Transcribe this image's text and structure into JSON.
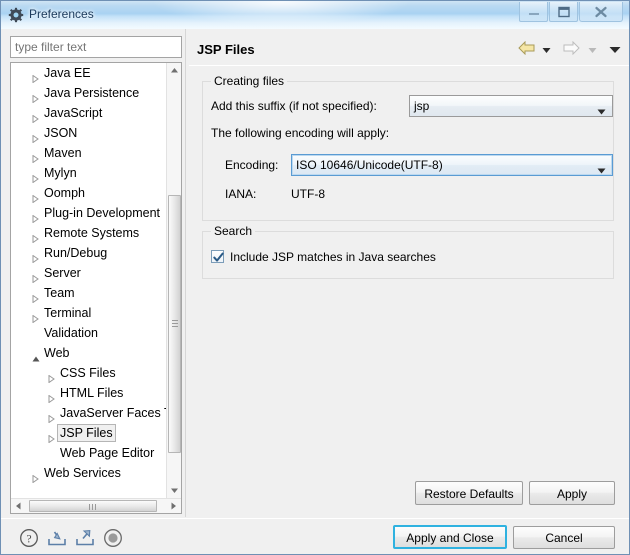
{
  "window": {
    "title": "Preferences",
    "icon": "gear-icon",
    "controls": {
      "minimize": "minimize-icon",
      "maximize": "maximize-icon",
      "close": "close-icon"
    }
  },
  "filter": {
    "value": "",
    "placeholder": "type filter text"
  },
  "tree": {
    "items": [
      {
        "label": "Java EE",
        "level": 1,
        "state": "collapsed",
        "selected": false
      },
      {
        "label": "Java Persistence",
        "level": 1,
        "state": "collapsed",
        "selected": false
      },
      {
        "label": "JavaScript",
        "level": 1,
        "state": "collapsed",
        "selected": false
      },
      {
        "label": "JSON",
        "level": 1,
        "state": "collapsed",
        "selected": false
      },
      {
        "label": "Maven",
        "level": 1,
        "state": "collapsed",
        "selected": false
      },
      {
        "label": "Mylyn",
        "level": 1,
        "state": "collapsed",
        "selected": false
      },
      {
        "label": "Oomph",
        "level": 1,
        "state": "collapsed",
        "selected": false
      },
      {
        "label": "Plug-in Development",
        "level": 1,
        "state": "collapsed",
        "selected": false
      },
      {
        "label": "Remote Systems",
        "level": 1,
        "state": "collapsed",
        "selected": false
      },
      {
        "label": "Run/Debug",
        "level": 1,
        "state": "collapsed",
        "selected": false
      },
      {
        "label": "Server",
        "level": 1,
        "state": "collapsed",
        "selected": false
      },
      {
        "label": "Team",
        "level": 1,
        "state": "collapsed",
        "selected": false
      },
      {
        "label": "Terminal",
        "level": 1,
        "state": "collapsed",
        "selected": false
      },
      {
        "label": "Validation",
        "level": 1,
        "state": "leaf",
        "selected": false
      },
      {
        "label": "Web",
        "level": 1,
        "state": "expanded",
        "selected": false
      },
      {
        "label": "CSS Files",
        "level": 2,
        "state": "collapsed",
        "selected": false
      },
      {
        "label": "HTML Files",
        "level": 2,
        "state": "collapsed",
        "selected": false
      },
      {
        "label": "JavaServer Faces To",
        "level": 2,
        "state": "collapsed",
        "selected": false
      },
      {
        "label": "JSP Files",
        "level": 2,
        "state": "collapsed",
        "selected": true
      },
      {
        "label": "Web Page Editor",
        "level": 2,
        "state": "leaf",
        "selected": false
      },
      {
        "label": "Web Services",
        "level": 1,
        "state": "collapsed",
        "selected": false
      }
    ]
  },
  "page": {
    "title": "JSP Files",
    "nav": {
      "back": "back-arrow-icon",
      "back_menu": "back-dropdown-icon",
      "forward": "forward-arrow-icon",
      "forward_menu": "forward-dropdown-icon",
      "menu": "view-menu-icon"
    },
    "groups": {
      "creating": {
        "title": "Creating files",
        "suffix_label": "Add this suffix (if not specified):",
        "suffix_value": "jsp",
        "encoding_note": "The following encoding will apply:",
        "encoding_label": "Encoding:",
        "encoding_value": "ISO 10646/Unicode(UTF-8)",
        "iana_label": "IANA:",
        "iana_value": "UTF-8"
      },
      "search": {
        "title": "Search",
        "checkbox_label": "Include JSP matches in Java searches",
        "checkbox_checked": true
      }
    },
    "buttons": {
      "restore_defaults": "Restore Defaults",
      "apply": "Apply"
    }
  },
  "bottom": {
    "icons": {
      "help": "help-icon",
      "import": "import-icon",
      "export": "export-icon",
      "record": "record-icon"
    },
    "apply_and_close": "Apply and Close",
    "cancel": "Cancel"
  },
  "colors": {
    "titlebar_accent": "#a9d2f2",
    "default_button_border": "#2fb2e0",
    "focus_border": "#5a9bd3",
    "back_arrow": "#f3e29a",
    "window_bg": "#f0f0f0"
  }
}
